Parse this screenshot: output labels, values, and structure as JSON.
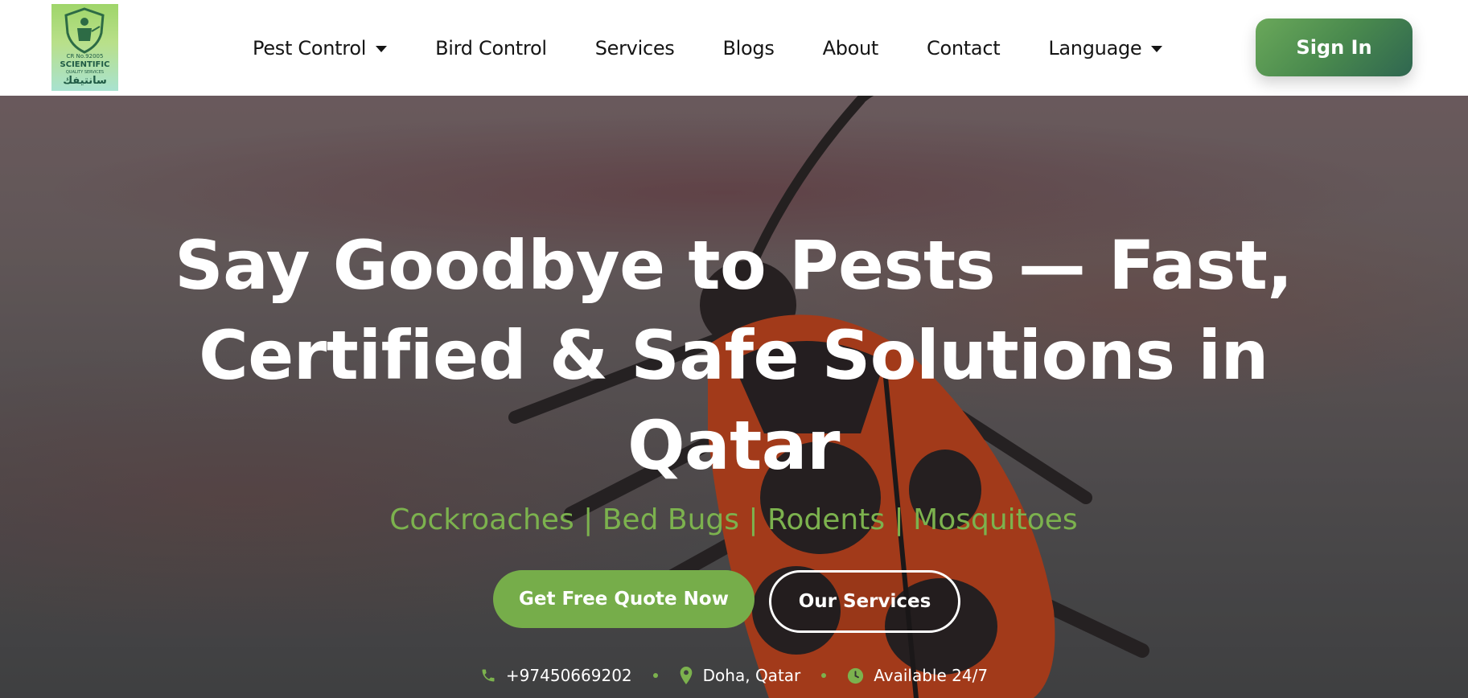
{
  "logo": {
    "alt": "Scientific Pest Control logo",
    "cr_text": "CR No.92005",
    "name_en": "SCIENTIFIC",
    "tagline": "QUALITY SERVICES",
    "name_ar": "سانتيفك"
  },
  "nav": {
    "items": [
      {
        "label": "Pest Control",
        "dropdown": true
      },
      {
        "label": "Bird Control",
        "dropdown": false
      },
      {
        "label": "Services",
        "dropdown": false
      },
      {
        "label": "Blogs",
        "dropdown": false
      },
      {
        "label": "About",
        "dropdown": false
      },
      {
        "label": "Contact",
        "dropdown": false
      },
      {
        "label": "Language",
        "dropdown": true
      }
    ],
    "signin_label": "Sign In"
  },
  "hero": {
    "title_line1": "Say Goodbye to Pests — Fast,",
    "title_line2": "Certified & Safe Solutions in",
    "title_line3": "Qatar",
    "subtitle": "Cockroaches | Bed Bugs | Rodents | Mosquitoes",
    "cta_primary": "Get Free Quote Now",
    "cta_secondary": "Our Services"
  },
  "contact": {
    "phone": "+97450669202",
    "location": "Doha, Qatar",
    "availability": "Available 24/7"
  },
  "colors": {
    "accent_green": "#76ad4a",
    "signin_gradient_start": "#6aa85a",
    "signin_gradient_end": "#2f6650",
    "bug_orange": "#e4501c"
  },
  "icons": {
    "phone": "phone-icon",
    "location": "map-pin-icon",
    "clock": "clock-icon",
    "caret": "caret-down-icon"
  }
}
